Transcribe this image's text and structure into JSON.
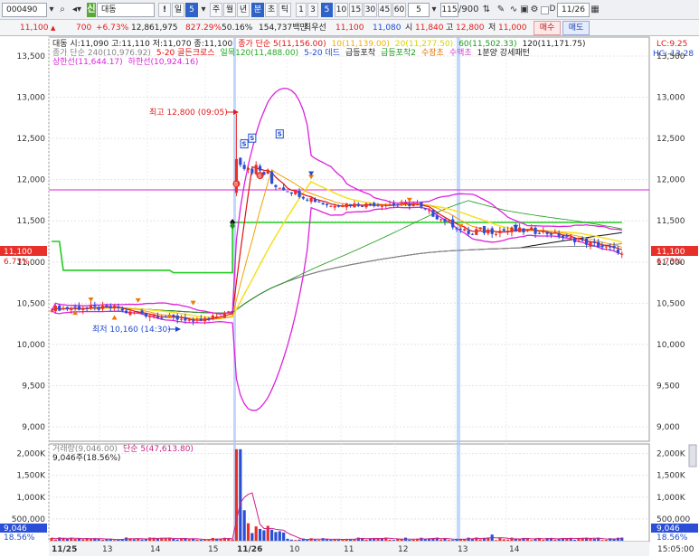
{
  "toolbar": {
    "code": "000490",
    "badge": "신",
    "name": "대동",
    "alert_label": "!",
    "day_label": "일",
    "day_num": "5",
    "periods": [
      "주",
      "월",
      "년",
      "분",
      "초",
      "틱"
    ],
    "minutes": [
      "1",
      "3",
      "5",
      "10",
      "15",
      "30",
      "45",
      "60"
    ],
    "selected_minute": "5",
    "count_value": "5",
    "range": "115",
    "range_total": "/900",
    "checkbox_label": "D",
    "date": "11/26"
  },
  "info": {
    "price": "11,100",
    "change": "700",
    "change_pct": "+6.73%",
    "volume": "12,861,975",
    "turnover_pct": "827.29%",
    "ratio": "50.16%",
    "amount": "154,737백만",
    "priority": "최우선",
    "bid1": "11,100",
    "bid2": "11,080",
    "open_label": "시",
    "open": "11,840",
    "high_label": "고",
    "high": "12,800",
    "low_label": "저",
    "low": "11,000",
    "buy_label": "매수",
    "sell_label": "매도"
  },
  "legend": {
    "line1": [
      {
        "text": "대동 시:11,090 고:11,110 저:11,070 종:11,100",
        "color": "#222222"
      },
      {
        "text": "종가 단순 5(11,156.00)",
        "color": "#e01010"
      },
      {
        "text": "10(11,139.00)",
        "color": "#f0b000"
      },
      {
        "text": "20(11,277.50)",
        "color": "#d6d400"
      },
      {
        "text": "60(11,502.33)",
        "color": "#1a9a1a"
      },
      {
        "text": "120(11,171.75)",
        "color": "#222222"
      }
    ],
    "line2": [
      {
        "text": "종가 단순 240(10,976.92)",
        "color": "#888888"
      },
      {
        "text": "5-20 골든크로스",
        "color": "#e01010"
      },
      {
        "text": "일목120(11,488.00)",
        "color": "#22aa22"
      },
      {
        "text": "5-20 데드",
        "color": "#1f4ad0"
      },
      {
        "text": "급등포착",
        "color": "#222222"
      },
      {
        "text": "급등포착2",
        "color": "#1a9a1a"
      },
      {
        "text": "수장초",
        "color": "#e07000"
      },
      {
        "text": "수액초",
        "color": "#cc44cc"
      },
      {
        "text": "1분양 강세패턴",
        "color": "#222222"
      }
    ],
    "line3": [
      {
        "text": "상한선(11,644.17)",
        "color": "#dd22dd"
      },
      {
        "text": "하한선(10,924.16)",
        "color": "#dd22dd"
      }
    ],
    "lc": "LC:9.25",
    "hc": "HC:-13.28"
  },
  "price_axis": {
    "ticks": [
      "13,500",
      "13,000",
      "12,500",
      "12,000",
      "11,500",
      "11,000",
      "10,500",
      "10,000",
      "9,500",
      "9,000"
    ],
    "current_price": "11,100",
    "current_pct": "6.73%"
  },
  "annotations": {
    "high": "최고 12,800 (09:05)",
    "low": "최저 10,160 (14:30)"
  },
  "volume": {
    "legend_title": "거래량(9,046.00)",
    "legend_ma": "단순 5(47,613.80)",
    "sub": "9,046주(18.56%)",
    "ticks": [
      "2,000K",
      "1,500K",
      "1,000K",
      "500,000"
    ],
    "current": "9,046",
    "current_pct": "18.56%"
  },
  "time_axis": {
    "labels": [
      "11/25",
      "13",
      "14",
      "15",
      "11/26",
      "10",
      "11",
      "12",
      "13",
      "14"
    ],
    "end_time": "15:05:00"
  },
  "colors": {
    "up": "#e8302a",
    "down": "#2a4fd6",
    "bollinger": "#dd22dd",
    "ma5": "#e01010",
    "ma10": "#f0a000",
    "ma20": "#f5e020",
    "ma60": "#1a9a1a",
    "ma120": "#111111",
    "ma240": "#888888",
    "cloud": "#22cc22",
    "accent": "#2f63c7"
  }
}
